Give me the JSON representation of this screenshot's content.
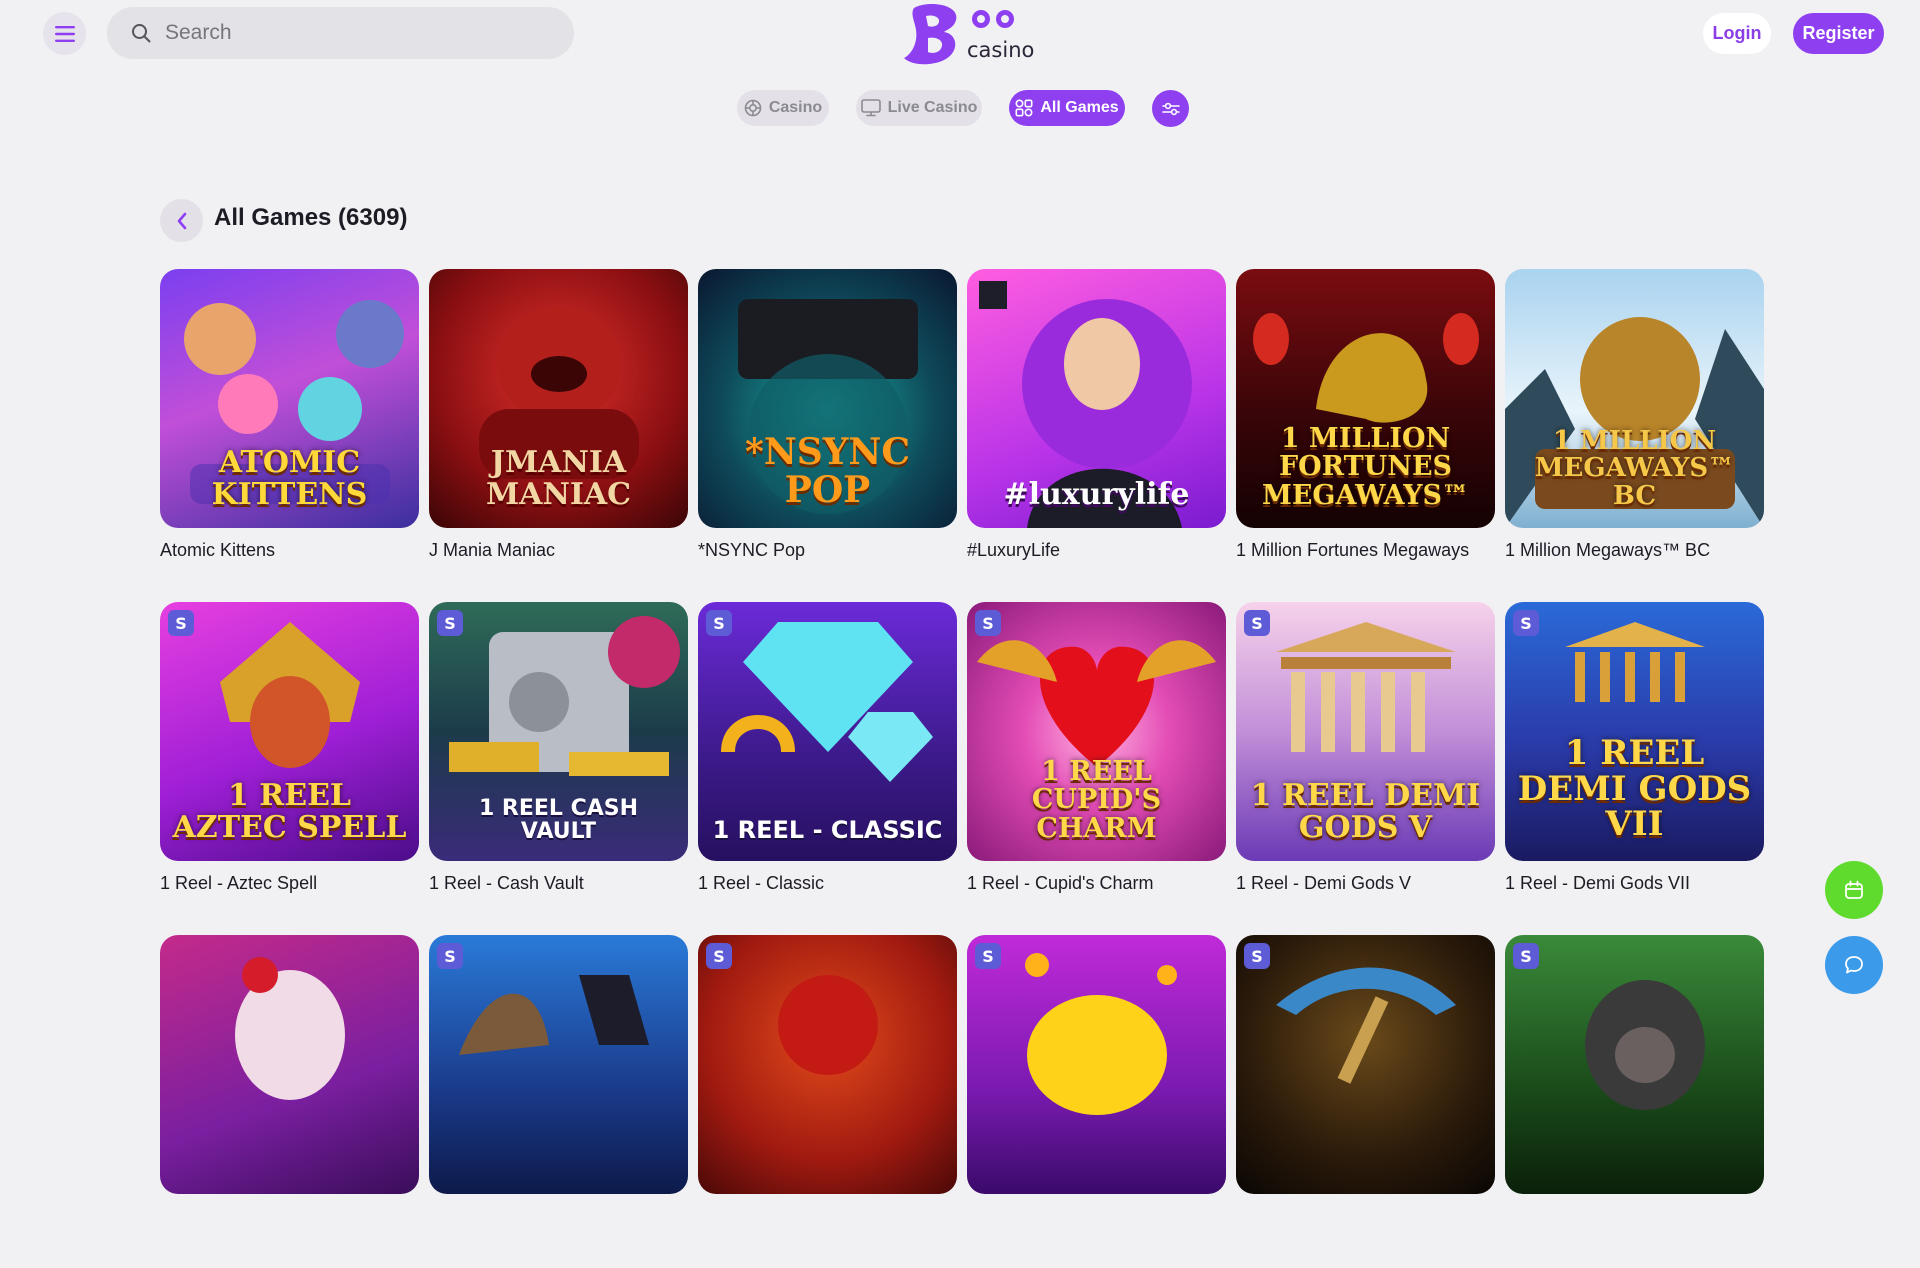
{
  "header": {
    "search_placeholder": "Search",
    "logo": {
      "mark": "Boo",
      "word": "casino"
    },
    "login_label": "Login",
    "register_label": "Register"
  },
  "tabs": [
    {
      "label": "Casino",
      "icon": "casino-chip-icon",
      "active": false
    },
    {
      "label": "Live Casino",
      "icon": "tv-icon",
      "active": false
    },
    {
      "label": "All Games",
      "icon": "grid-icon",
      "active": true
    }
  ],
  "section": {
    "title": "All Games (6309)"
  },
  "games": [
    {
      "name": "Atomic Kittens",
      "art": "ATOMIC KITTENS",
      "badge": ""
    },
    {
      "name": "J Mania Maniac",
      "art": "JMANIA MANIAC",
      "badge": ""
    },
    {
      "name": "*NSYNC Pop",
      "art": "*NSYNC POP",
      "badge": ""
    },
    {
      "name": "#LuxuryLife",
      "art": "#luxurylife",
      "badge": ""
    },
    {
      "name": "1 Million Fortunes Megaways",
      "art": "1 MILLION FORTUNES MEGAWAYS™",
      "badge": ""
    },
    {
      "name": "1 Million Megaways™ BC",
      "art": "1 MILLION MEGAWAYS™ BC",
      "badge": ""
    },
    {
      "name": "1 Reel - Aztec Spell",
      "art": "1 REEL AZTEC SPELL",
      "badge": "S"
    },
    {
      "name": "1 Reel - Cash Vault",
      "art": "1 REEL CASH VAULT",
      "badge": "S"
    },
    {
      "name": "1 Reel - Classic",
      "art": "1 REEL - CLASSIC",
      "badge": "S"
    },
    {
      "name": "1 Reel - Cupid's Charm",
      "art": "1 REEL CUPID'S CHARM",
      "badge": "S"
    },
    {
      "name": "1 Reel - Demi Gods V",
      "art": "1 REEL DEMI GODS V",
      "badge": "S"
    },
    {
      "name": "1 Reel - Demi Gods VII",
      "art": "1 REEL DEMI GODS VII",
      "badge": "S"
    },
    {
      "name": "",
      "art": "",
      "badge": ""
    },
    {
      "name": "",
      "art": "",
      "badge": "S"
    },
    {
      "name": "",
      "art": "",
      "badge": "S"
    },
    {
      "name": "",
      "art": "",
      "badge": "S"
    },
    {
      "name": "",
      "art": "",
      "badge": "S"
    },
    {
      "name": "",
      "art": "",
      "badge": "S"
    }
  ],
  "colors": {
    "accent": "#8e3ff0",
    "background": "#f1f0f3",
    "calendar_button": "#5fdb2e",
    "chat_button": "#3b9bea"
  },
  "icons": {
    "menu": "hamburger-icon",
    "search": "search-icon",
    "filter": "filter-sliders-icon",
    "back": "chevron-left-icon",
    "calendar": "calendar-icon",
    "chat": "chat-bubble-icon"
  }
}
